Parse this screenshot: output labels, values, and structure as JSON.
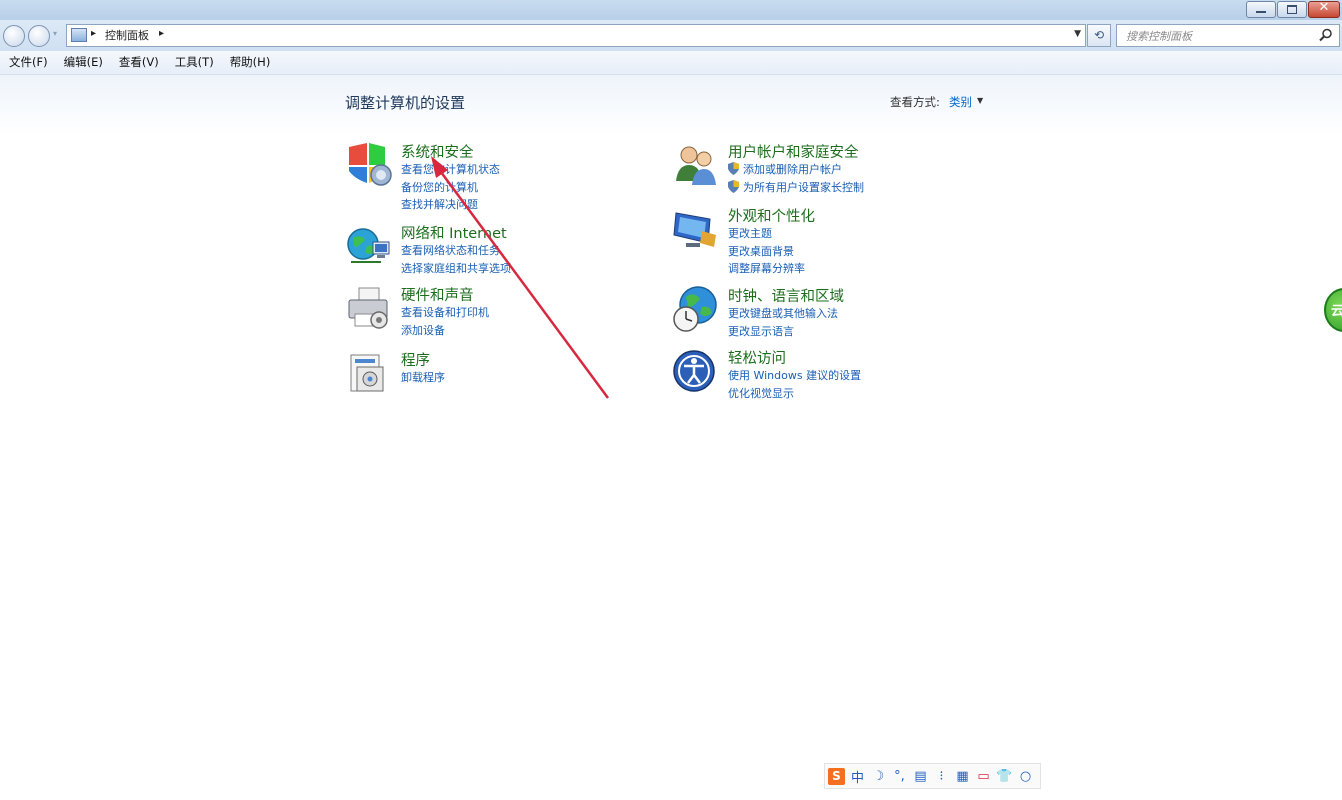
{
  "window": {
    "controls": {
      "minimize": "minimize-icon",
      "maximize": "maximize-icon",
      "close": "close-icon"
    }
  },
  "address_bar": {
    "breadcrumb": [
      "控制面板"
    ],
    "search_placeholder": "搜索控制面板"
  },
  "menu": [
    "文件(F)",
    "编辑(E)",
    "查看(V)",
    "工具(T)",
    "帮助(H)"
  ],
  "main": {
    "title": "调整计算机的设置",
    "view_by_label": "查看方式:",
    "view_by_value": "类别"
  },
  "categories_left": [
    {
      "title": "系统和安全",
      "icon": "shield-icon",
      "links": [
        "查看您的计算机状态",
        "备份您的计算机",
        "查找并解决问题"
      ]
    },
    {
      "title": "网络和 Internet",
      "icon": "network-globe-icon",
      "links": [
        "查看网络状态和任务",
        "选择家庭组和共享选项"
      ]
    },
    {
      "title": "硬件和声音",
      "icon": "printer-icon",
      "links": [
        "查看设备和打印机",
        "添加设备"
      ]
    },
    {
      "title": "程序",
      "icon": "programs-icon",
      "links": [
        "卸载程序"
      ]
    }
  ],
  "categories_right": [
    {
      "title": "用户帐户和家庭安全",
      "icon": "users-icon",
      "links": [
        "添加或删除用户帐户",
        "为所有用户设置家长控制"
      ]
    },
    {
      "title": "外观和个性化",
      "icon": "appearance-monitor-icon",
      "links": [
        "更改主题",
        "更改桌面背景",
        "调整屏幕分辨率"
      ]
    },
    {
      "title": "时钟、语言和区域",
      "icon": "clock-globe-icon",
      "links": [
        "更改键盘或其他输入法",
        "更改显示语言"
      ]
    },
    {
      "title": "轻松访问",
      "icon": "ease-of-access-icon",
      "links": [
        "使用 Windows 建议的设置",
        "优化视觉显示"
      ]
    }
  ],
  "ime_toolbar": {
    "mode": "中",
    "icons": [
      "ime-logo-icon",
      "moon-icon",
      "punctuation-icon",
      "keyboard-icon",
      "tools-icon",
      "grid-icon",
      "game-icon",
      "shirt-icon",
      "circle-icon"
    ]
  },
  "colors": {
    "category_title": "#1c6e1c",
    "link": "#1a5fb4",
    "annotation_arrow": "#d8283f"
  }
}
